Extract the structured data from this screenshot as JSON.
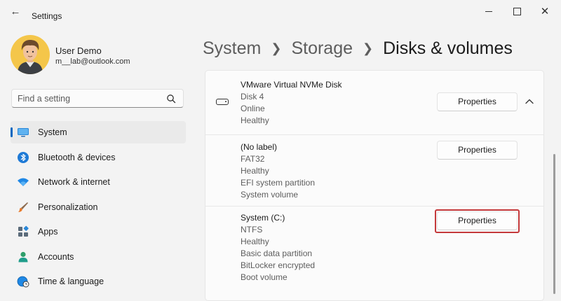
{
  "window": {
    "title": "Settings",
    "back_icon": "arrow-left-icon",
    "controls": [
      "minimize",
      "maximize",
      "close"
    ]
  },
  "profile": {
    "name": "User Demo",
    "email": "m__lab@outlook.com"
  },
  "search": {
    "placeholder": "Find a setting",
    "value": ""
  },
  "sidebar": {
    "items": [
      {
        "label": "System",
        "icon": "monitor-icon",
        "active": true
      },
      {
        "label": "Bluetooth & devices",
        "icon": "bluetooth-icon"
      },
      {
        "label": "Network & internet",
        "icon": "wifi-icon"
      },
      {
        "label": "Personalization",
        "icon": "brush-icon"
      },
      {
        "label": "Apps",
        "icon": "apps-icon"
      },
      {
        "label": "Accounts",
        "icon": "person-icon"
      },
      {
        "label": "Time & language",
        "icon": "globe-clock-icon"
      }
    ]
  },
  "breadcrumb": {
    "items": [
      "System",
      "Storage"
    ],
    "current": "Disks & volumes"
  },
  "disk": {
    "name": "VMware Virtual NVMe Disk",
    "lines": [
      "Disk 4",
      "Online",
      "Healthy"
    ],
    "button": "Properties",
    "expanded": true
  },
  "volumes": [
    {
      "label": "(No label)",
      "lines": [
        "FAT32",
        "Healthy",
        "EFI system partition",
        "System volume"
      ],
      "button": "Properties"
    },
    {
      "label": "System (C:)",
      "lines": [
        "NTFS",
        "Healthy",
        "Basic data partition",
        "BitLocker encrypted",
        "Boot volume"
      ],
      "button": "Properties",
      "highlighted": true
    }
  ],
  "colors": {
    "accent": "#0067c0",
    "highlight": "#c4393b",
    "background": "#f3f3f3"
  }
}
